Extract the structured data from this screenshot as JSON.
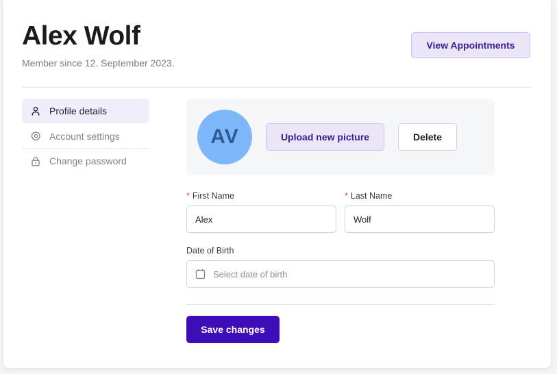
{
  "header": {
    "name": "Alex Wolf",
    "member_since": "Member since 12. September 2023.",
    "view_appointments_label": "View Appointments"
  },
  "nav": {
    "items": [
      {
        "label": "Profile details",
        "icon": "user-icon",
        "active": true
      },
      {
        "label": "Account settings",
        "icon": "gear-icon",
        "active": false
      },
      {
        "label": "Change password",
        "icon": "lock-icon",
        "active": false
      }
    ]
  },
  "profile_photo": {
    "initials": "AV",
    "avatar_color": "#7fb8fa",
    "upload_label": "Upload new picture",
    "delete_label": "Delete"
  },
  "form": {
    "first_name": {
      "label": "First Name",
      "value": "Alex",
      "required": true
    },
    "last_name": {
      "label": "Last Name",
      "value": "Wolf",
      "required": true
    },
    "dob": {
      "label": "Date of Birth",
      "placeholder": "Select date of birth"
    },
    "save_label": "Save changes"
  },
  "colors": {
    "primary": "#3d0db8",
    "accent_soft": "#ebe5f8",
    "required": "#e5484d"
  }
}
